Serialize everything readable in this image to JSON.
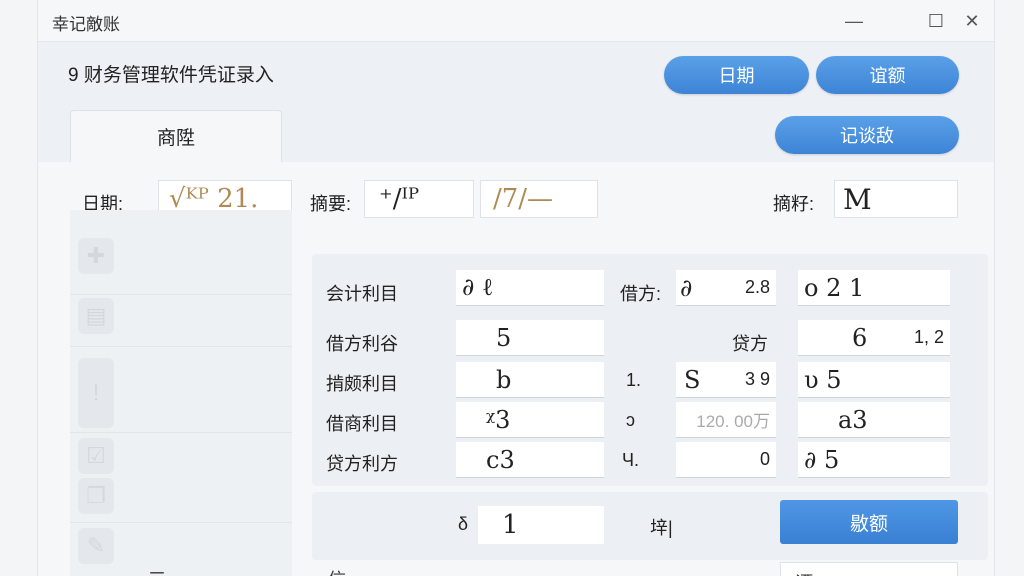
{
  "window": {
    "title": "幸记敵账",
    "minimize": "—",
    "maximize": "☐",
    "close": "✕"
  },
  "header": {
    "app_title": "9 财务管理软件凭证录入",
    "btn_date": "日期",
    "btn_amount": "谊额",
    "btn_record": "记谈敌",
    "tab_label": "商陞"
  },
  "form": {
    "date_label": "日期:",
    "date_value": "√ᴷᴾ 21.",
    "summary_label": "摘要:",
    "summary_value1": "⁺/ᴵᴾ",
    "summary_value2": "/7/—",
    "summary2_label": "摘籽:",
    "summary2_value": "M"
  },
  "grid": {
    "rows": [
      {
        "label": "会计利目",
        "c1": "∂ ℓ",
        "mid_label": "借方:",
        "c2_pre": "∂",
        "c2": "2.8",
        "c3": "о 2 1"
      },
      {
        "label": "借方利谷",
        "c1": "5",
        "mid_label": "",
        "c2_pre": "",
        "c2": "",
        "right_label": "贷方",
        "c3": "6",
        "c3_num": "1, 2"
      },
      {
        "label": "掯颇利目",
        "c1": "b",
        "mid_label": "1.",
        "c2_pre": "S",
        "c2": "3 9",
        "c3": "υ 5"
      },
      {
        "label": "借商利目",
        "c1": "ᵡ3",
        "mid_label": "ↄ",
        "c2_pre": "",
        "c2": "120. 00万",
        "c3": "a3"
      },
      {
        "label": "贷方利方",
        "c1": "c3",
        "mid_label": "Ч.",
        "c2_pre": "",
        "c2": "0",
        "c3": "∂ 5"
      }
    ]
  },
  "bottom": {
    "input_prefix": "δ",
    "input_value": "1",
    "mid_text": "垶|",
    "btn_label": "敭额"
  },
  "cutoff": {
    "t1": "三",
    "t2": "信",
    "t3": "...",
    "t4": "谭 ⌐"
  },
  "colors": {
    "accent": "#3d84d6",
    "background": "#edf0f4"
  }
}
